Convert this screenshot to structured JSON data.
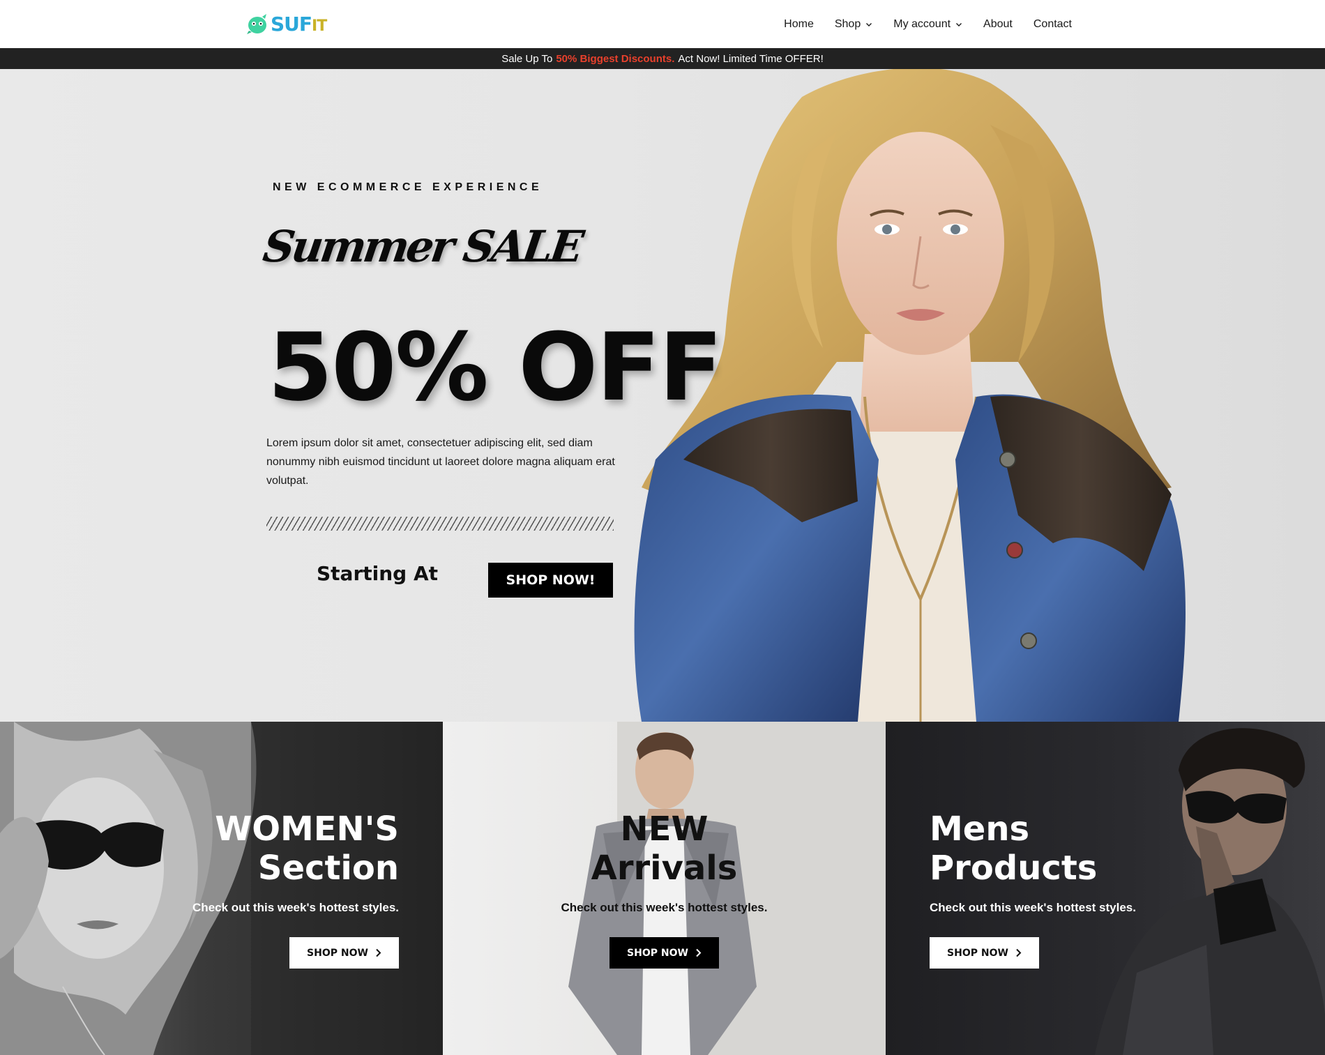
{
  "brand": {
    "name_part1": "SUF",
    "name_part2": "IT",
    "color_primary": "#2aa7d9",
    "color_secondary": "#c9b227",
    "mark_color": "#3fd2a0"
  },
  "nav": {
    "items": [
      {
        "label": "Home",
        "has_dropdown": false
      },
      {
        "label": "Shop",
        "has_dropdown": true
      },
      {
        "label": "My account",
        "has_dropdown": true
      },
      {
        "label": "About",
        "has_dropdown": false
      },
      {
        "label": "Contact",
        "has_dropdown": false
      }
    ]
  },
  "announcement": {
    "prefix": "Sale Up To",
    "highlight": "50% Biggest Discounts.",
    "suffix": "Act Now! Limited Time OFFER!",
    "highlight_color": "#e8402c"
  },
  "hero": {
    "eyebrow": "NEW ECOMMERCE EXPERIENCE",
    "script_title": "Summer SALE",
    "headline": "50% OFF",
    "body": "Lorem ipsum dolor sit amet, consectetuer adipiscing elit, sed diam nonummy nibh euismod tincidunt ut laoreet dolore magna aliquam erat volutpat.",
    "starting_label": "Starting At",
    "cta_label": "SHOP NOW!"
  },
  "categories": [
    {
      "title_line1": "WOMEN'S",
      "title_line2": "Section",
      "subtitle": "Check out this week's hottest styles.",
      "cta_label": "SHOP NOW"
    },
    {
      "title_line1": "NEW",
      "title_line2": "Arrivals",
      "subtitle": "Check out this week's hottest styles.",
      "cta_label": "SHOP NOW"
    },
    {
      "title_line1": "Mens",
      "title_line2": "Products",
      "subtitle": "Check out this week's hottest styles.",
      "cta_label": "SHOP NOW"
    }
  ],
  "icons": {
    "dropdown": "chevron-down-icon",
    "button_arrow": "chevron-right-icon"
  }
}
